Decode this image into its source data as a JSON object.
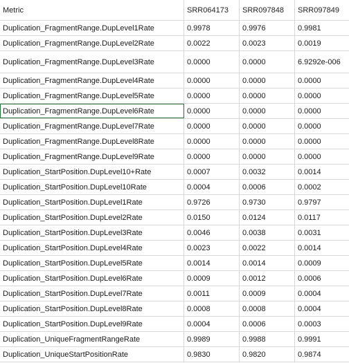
{
  "columns": [
    "Metric",
    "SRR064173",
    "SRR097848",
    "SRR097849"
  ],
  "rows": [
    {
      "metric": "Duplication_FragmentRange.DupLevel1Rate",
      "v1": "0.9978",
      "v2": "0.9976",
      "v3": "0.9981"
    },
    {
      "metric": "Duplication_FragmentRange.DupLevel2Rate",
      "v1": "0.0022",
      "v2": "0.0023",
      "v3": "0.0019"
    },
    {
      "metric": "Duplication_FragmentRange.DupLevel3Rate",
      "v1": "0.0000",
      "v2": "0.0000",
      "v3": "6.9292e-006"
    },
    {
      "metric": "Duplication_FragmentRange.DupLevel4Rate",
      "v1": "0.0000",
      "v2": "0.0000",
      "v3": "0.0000"
    },
    {
      "metric": "Duplication_FragmentRange.DupLevel5Rate",
      "v1": "0.0000",
      "v2": "0.0000",
      "v3": "0.0000"
    },
    {
      "metric": "Duplication_FragmentRange.DupLevel6Rate",
      "v1": "0.0000",
      "v2": "0.0000",
      "v3": "0.0000"
    },
    {
      "metric": "Duplication_FragmentRange.DupLevel7Rate",
      "v1": "0.0000",
      "v2": "0.0000",
      "v3": "0.0000"
    },
    {
      "metric": "Duplication_FragmentRange.DupLevel8Rate",
      "v1": "0.0000",
      "v2": "0.0000",
      "v3": "0.0000"
    },
    {
      "metric": "Duplication_FragmentRange.DupLevel9Rate",
      "v1": "0.0000",
      "v2": "0.0000",
      "v3": "0.0000"
    },
    {
      "metric": "Duplication_StartPosition.DupLevel10+Rate",
      "v1": "0.0007",
      "v2": "0.0032",
      "v3": "0.0014"
    },
    {
      "metric": "Duplication_StartPosition.DupLevel10Rate",
      "v1": "0.0004",
      "v2": "0.0006",
      "v3": "0.0002"
    },
    {
      "metric": "Duplication_StartPosition.DupLevel1Rate",
      "v1": "0.9726",
      "v2": "0.9730",
      "v3": "0.9797"
    },
    {
      "metric": "Duplication_StartPosition.DupLevel2Rate",
      "v1": "0.0150",
      "v2": "0.0124",
      "v3": "0.0117"
    },
    {
      "metric": "Duplication_StartPosition.DupLevel3Rate",
      "v1": "0.0046",
      "v2": "0.0038",
      "v3": "0.0031"
    },
    {
      "metric": "Duplication_StartPosition.DupLevel4Rate",
      "v1": "0.0023",
      "v2": "0.0022",
      "v3": "0.0014"
    },
    {
      "metric": "Duplication_StartPosition.DupLevel5Rate",
      "v1": "0.0014",
      "v2": "0.0014",
      "v3": "0.0009"
    },
    {
      "metric": "Duplication_StartPosition.DupLevel6Rate",
      "v1": "0.0009",
      "v2": "0.0012",
      "v3": "0.0006"
    },
    {
      "metric": "Duplication_StartPosition.DupLevel7Rate",
      "v1": "0.0011",
      "v2": "0.0009",
      "v3": "0.0004"
    },
    {
      "metric": "Duplication_StartPosition.DupLevel8Rate",
      "v1": "0.0008",
      "v2": "0.0008",
      "v3": "0.0004"
    },
    {
      "metric": "Duplication_StartPosition.DupLevel9Rate",
      "v1": "0.0004",
      "v2": "0.0006",
      "v3": "0.0003"
    },
    {
      "metric": "Duplication_UniqueFragmentRangeRate",
      "v1": "0.9989",
      "v2": "0.9988",
      "v3": "0.9991"
    },
    {
      "metric": "Duplication_UniqueStartPositionRate",
      "v1": "0.9830",
      "v2": "0.9820",
      "v3": "0.9874"
    }
  ],
  "selected_row_metric": "Duplication_FragmentRange.DupLevel6Rate"
}
